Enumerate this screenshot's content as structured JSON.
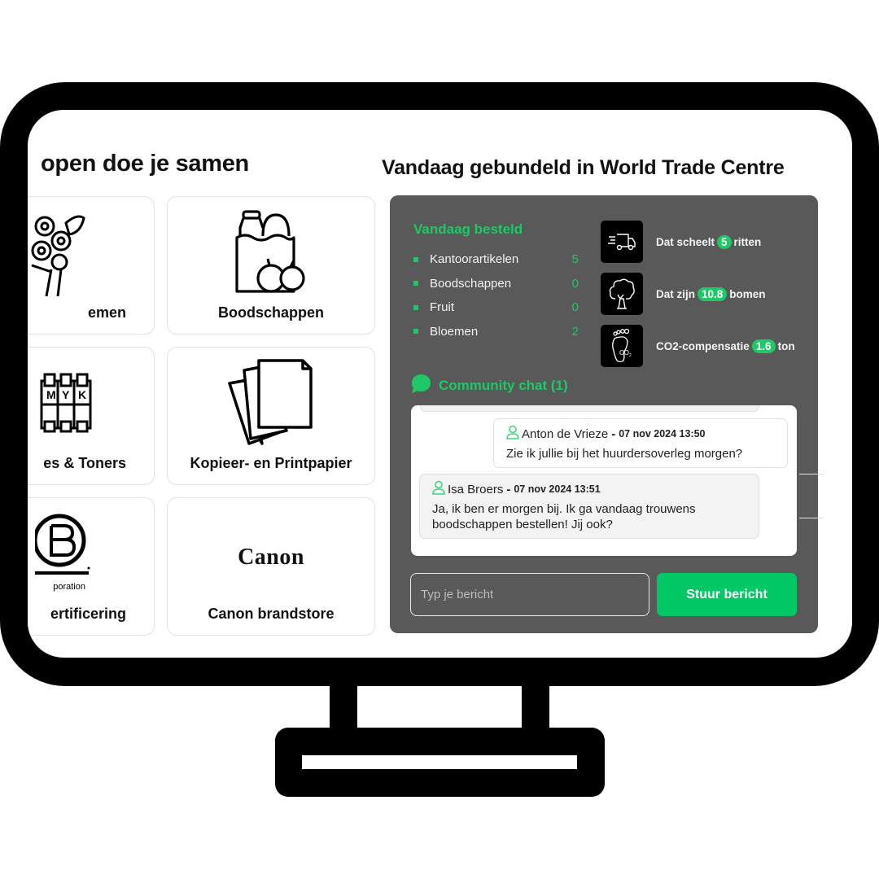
{
  "left_section": {
    "title": "open doe je samen",
    "tiles": [
      {
        "label": "Bloemen",
        "visible_label": "emen",
        "icon": "flower-bouquet-icon"
      },
      {
        "label": "Boodschappen",
        "icon": "grocery-bag-icon"
      },
      {
        "label": "Cartridges & Toners",
        "visible_label": "es & Toners",
        "icon": "cmyk-cartridge-icon"
      },
      {
        "label": "Kopieer- en Printpapier",
        "icon": "paper-stack-icon"
      },
      {
        "label": "B Corp certificering",
        "visible_label": "ertificering",
        "icon": "b-corp-logo",
        "logo_caption": "poration"
      },
      {
        "label": "Canon brandstore",
        "icon": "canon-logo",
        "logo_text": "Canon"
      }
    ]
  },
  "right_section": {
    "title": "Vandaag gebundeld in World Trade Centre",
    "ordered": {
      "title": "Vandaag besteld",
      "items": [
        {
          "label": "Kantoorartikelen",
          "count": "5"
        },
        {
          "label": "Boodschappen",
          "count": "0"
        },
        {
          "label": "Fruit",
          "count": "0"
        },
        {
          "label": "Bloemen",
          "count": "2"
        }
      ]
    },
    "stats": [
      {
        "icon": "delivery-truck-icon",
        "prefix": "Dat scheelt",
        "value": "5",
        "suffix": "ritten"
      },
      {
        "icon": "tree-icon",
        "prefix": "Dat zijn",
        "value": "10.8",
        "suffix": "bomen"
      },
      {
        "icon": "co2-footprint-icon",
        "prefix": "CO2-compensatie",
        "value": "1.6",
        "suffix": "ton"
      }
    ],
    "chat": {
      "title": "Community chat (1)",
      "messages": [
        {
          "author": "Anton de Vrieze",
          "separator": "-",
          "time": "07 nov 2024 13:50",
          "text": "Zie ik jullie bij het huurdersoverleg morgen?"
        },
        {
          "author": "Isa Broers",
          "separator": "-",
          "time": "07 nov 2024 13:51",
          "text": "Ja, ik ben er morgen bij. Ik ga vandaag trouwens boodschappen bestellen! Jij ook?"
        }
      ],
      "input_value": "",
      "input_placeholder": "Typ je bericht",
      "send_label": "Stuur bericht"
    }
  },
  "colors": {
    "accent_green": "#1ec866",
    "button_green": "#02c865",
    "panel_gray": "#595959",
    "frame_black": "#000000"
  }
}
